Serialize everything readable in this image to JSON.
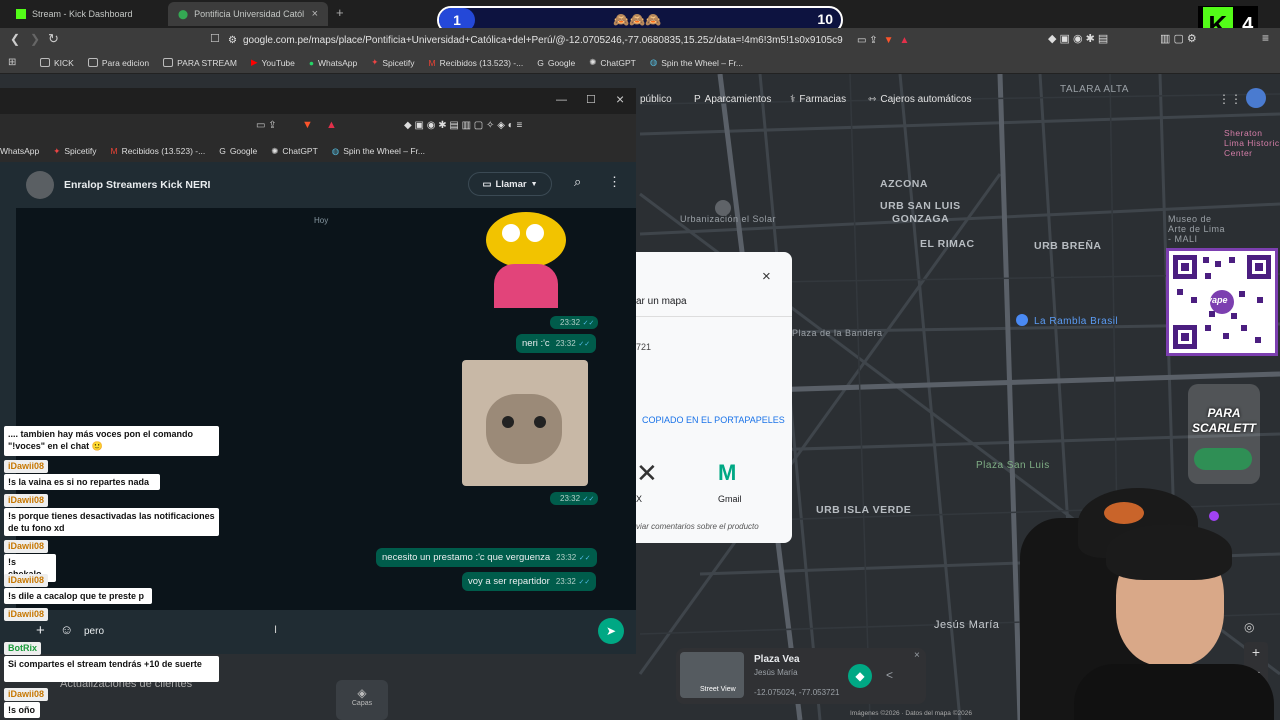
{
  "tabs": [
    {
      "label": "Stream - Kick Dashboard",
      "icon": "kick-icon"
    },
    {
      "label": "Pontificia Universidad Católica d",
      "icon": "maps-pin-icon"
    }
  ],
  "omnibox": {
    "url": "google.com.pe/maps/place/Pontificia+Universidad+Católica+del+Perú/@-12.0705246,-77.0680835,15.25z/data=!4m6!3m5!1s0x9105c912d408..."
  },
  "bookmarks": [
    "KICK",
    "Para edicion",
    "PARA STREAM",
    "YouTube",
    "WhatsApp",
    "Spicetify",
    "Recibidos (13.523) -...",
    "Google",
    "ChatGPT",
    "Spin the Wheel – Fr..."
  ],
  "wa_bookmarks": [
    "WhatsApp",
    "Spicetify",
    "Recibidos (13.523) -...",
    "Google",
    "ChatGPT",
    "Spin the Wheel – Fr..."
  ],
  "map": {
    "chips": [
      "público",
      "Aparcamientos",
      "Farmacias",
      "Cajeros automáticos"
    ],
    "labels": [
      "TALARA ALTA",
      "AZCONA",
      "URB SAN LUIS",
      "GONZAGA",
      "EL RIMAC",
      "URB BREÑA",
      "URB ISLA VERDE",
      "Jesús María",
      "La Rambla Brasil",
      "Plaza San Luis",
      "Urbanización el Solar",
      "Museo de Arte de Lima - MALI",
      "Sheraton Lima Historic Center",
      "Plaza de la Bandera"
    ],
    "footer": "Imágenes ©2026 · Datos del mapa ©2026",
    "place_card": {
      "name": "Plaza Vea",
      "area": "Jesús María",
      "coords": "-12.075024, -77.053721",
      "thumb_label": "Street View"
    },
    "layers_label": "Capas",
    "updates_label": "Actualizaciones de clientes"
  },
  "share": {
    "title_partial": "ar un mapa",
    "coords_partial": "721",
    "copied": "COPIADO EN EL PORTAPAPELES",
    "x_label": "X",
    "gmail_label": "Gmail",
    "feedback": "viar comentarios sobre el producto"
  },
  "whatsapp": {
    "chat_name": "Enralop Streamers Kick NERI",
    "call_label": "Llamar",
    "date_label": "Hoy",
    "messages": [
      {
        "text": "",
        "time": "23:32"
      },
      {
        "text": "neri :'c",
        "time": "23:32"
      },
      {
        "text": "",
        "time": "23:32"
      },
      {
        "text": "necesito un prestamo :'c que verguenza",
        "time": "23:32"
      },
      {
        "text": "voy a ser repartidor",
        "time": "23:32"
      }
    ],
    "input_text": "pero"
  },
  "stream_chat": [
    {
      "user": "",
      "msg": ".... tambien hay más voces pon el comando \"!voces\" en el chat 🙂"
    },
    {
      "user": "iDawii08",
      "msg": "!s la vaina es si no repartes nada"
    },
    {
      "user": "iDawii08",
      "msg": "!s porque tienes desactivadas las notificaciones de tu fono xd"
    },
    {
      "user": "iDawii08",
      "msg": "!s chekalo"
    },
    {
      "user": "iDawii08",
      "msg": "!s dile a cacalop que te preste p"
    },
    {
      "user": "iDawii08",
      "msg": ""
    },
    {
      "user": "BotRix",
      "msg": "Si compartes el stream tendrás +10 de suerte"
    },
    {
      "user": "iDawii08",
      "msg": "!s oño"
    }
  ],
  "score": {
    "left": "1",
    "right": "10",
    "emojis": "🙈🙈🙈"
  },
  "kick_badge": {
    "letter": "K",
    "count": "4"
  },
  "overlay": {
    "para_scarlett": "PARA SCARLETT",
    "yape": "yape"
  },
  "colors": {
    "kick_green": "#53fc18",
    "wa_green": "#005c4b",
    "send_green": "#00a884",
    "chat_name_color": "#c77700"
  }
}
